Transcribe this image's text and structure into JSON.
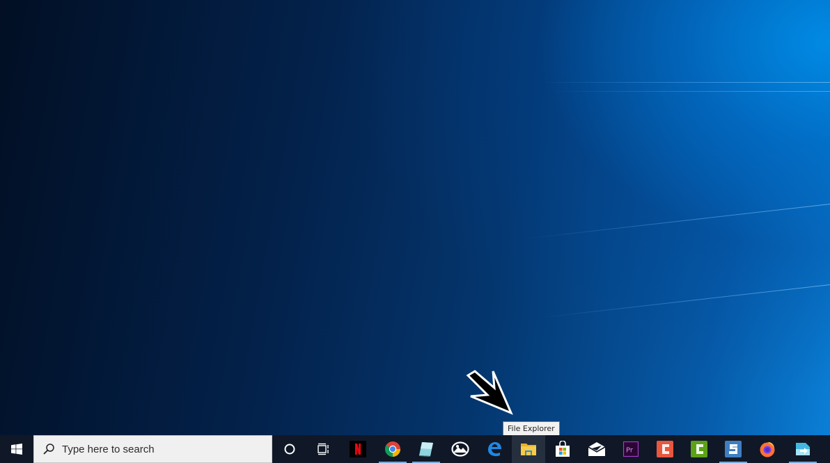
{
  "tooltip": {
    "text": "File Explorer"
  },
  "search": {
    "placeholder": "Type here to search"
  },
  "taskbar": {
    "start": {
      "icon": "windows-logo-icon"
    },
    "cortana": {
      "icon": "cortana-circle-icon"
    },
    "task_view": {
      "icon": "task-view-icon"
    },
    "apps": [
      {
        "name": "Netflix",
        "icon": "netflix-icon",
        "running": false,
        "hovered": false
      },
      {
        "name": "Google Chrome",
        "icon": "chrome-icon",
        "running": true,
        "hovered": false
      },
      {
        "name": "Notepad",
        "icon": "notepad-icon",
        "running": true,
        "hovered": false
      },
      {
        "name": "Photos",
        "icon": "photos-icon",
        "running": false,
        "hovered": false
      },
      {
        "name": "Microsoft Edge",
        "icon": "edge-icon",
        "running": false,
        "hovered": false
      },
      {
        "name": "File Explorer",
        "icon": "folder-icon",
        "running": false,
        "hovered": true
      },
      {
        "name": "Microsoft Store",
        "icon": "store-icon",
        "running": false,
        "hovered": false
      },
      {
        "name": "Mail",
        "icon": "mail-icon",
        "running": false,
        "hovered": false
      },
      {
        "name": "Adobe Premiere Pro",
        "icon": "premiere-icon",
        "running": false,
        "hovered": false
      },
      {
        "name": "Camtasia",
        "icon": "camtasia-icon",
        "running": false,
        "hovered": false
      },
      {
        "name": "Camtasia Recorder",
        "icon": "camtasia-recorder-icon",
        "running": false,
        "hovered": false
      },
      {
        "name": "Snagit",
        "icon": "snagit-icon",
        "running": true,
        "hovered": false
      },
      {
        "name": "Firefox",
        "icon": "firefox-icon",
        "running": false,
        "hovered": false
      },
      {
        "name": "Snagit Editor",
        "icon": "snagit-editor-icon",
        "running": true,
        "hovered": false
      }
    ]
  },
  "colors": {
    "taskbar_bg": "#101827",
    "running_indicator": "#76a8d6",
    "search_bg": "#f0f0f0",
    "tooltip_bg": "#f2f2f2"
  }
}
